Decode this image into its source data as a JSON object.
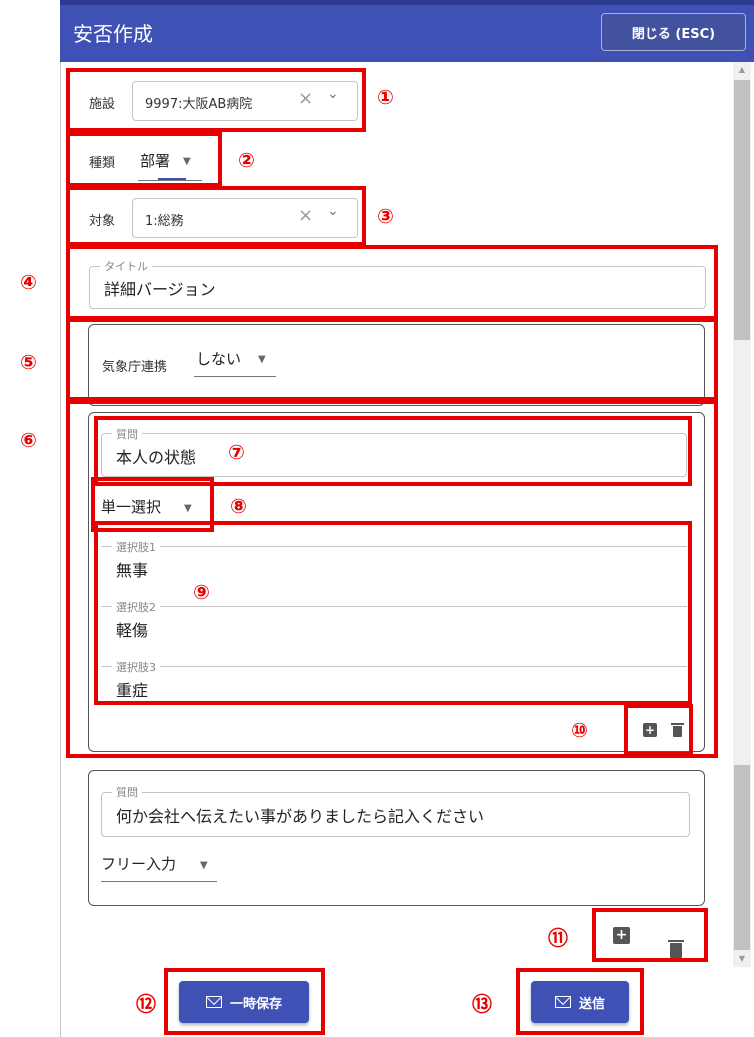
{
  "header": {
    "title": "安否作成",
    "close_label": "閉じる (ESC)"
  },
  "facility": {
    "label": "施設",
    "value": "9997:大阪AB病院"
  },
  "type": {
    "label": "種類",
    "value": "部署"
  },
  "target": {
    "label": "対象",
    "value": "1:総務"
  },
  "title_field": {
    "label": "タイトル",
    "value": "詳細バージョン"
  },
  "jma": {
    "label": "気象庁連携",
    "value": "しない"
  },
  "questions": [
    {
      "label": "質問",
      "value": "本人の状態",
      "type": "単一選択",
      "options": [
        {
          "label": "選択肢1",
          "value": "無事"
        },
        {
          "label": "選択肢2",
          "value": "軽傷"
        },
        {
          "label": "選択肢3",
          "value": "重症"
        }
      ]
    },
    {
      "label": "質問",
      "value": "何か会社へ伝えたい事がありましたら記入ください",
      "type": "フリー入力"
    }
  ],
  "footer": {
    "save_label": "一時保存",
    "send_label": "送信"
  },
  "callouts": [
    "①",
    "②",
    "③",
    "④",
    "⑤",
    "⑥",
    "⑦",
    "⑧",
    "⑨",
    "⑩",
    "⑪",
    "⑫",
    "⑬"
  ],
  "icons": {
    "clear": "×",
    "chevron": "⌄",
    "dropdown": "▼",
    "plus": "+"
  },
  "colors": {
    "header": "#3f51b5",
    "callout_red": "#e60000",
    "button_blue": "#3f51b5"
  }
}
